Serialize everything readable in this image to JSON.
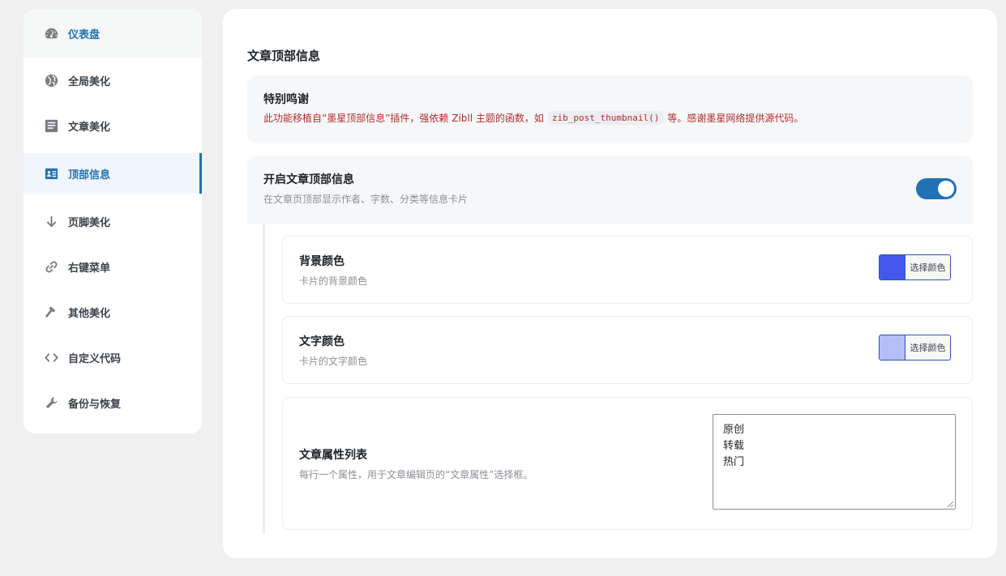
{
  "sidebar": {
    "items": [
      {
        "label": "仪表盘",
        "icon": "dashboard-icon"
      },
      {
        "label": "全局美化",
        "icon": "globe-icon"
      },
      {
        "label": "文章美化",
        "icon": "document-icon"
      },
      {
        "label": "顶部信息",
        "icon": "id-card-icon"
      },
      {
        "label": "页脚美化",
        "icon": "arrow-down-icon"
      },
      {
        "label": "右键菜单",
        "icon": "link-icon"
      },
      {
        "label": "其他美化",
        "icon": "hammer-icon"
      },
      {
        "label": "自定义代码",
        "icon": "code-icon"
      },
      {
        "label": "备份与恢复",
        "icon": "wrench-icon"
      }
    ],
    "active_index": 3
  },
  "main": {
    "section_title": "文章顶部信息",
    "thanks": {
      "title": "特别鸣谢",
      "text_before": "此功能移植自“墨星顶部信息”插件，强依赖 Zibll 主题的函数，如",
      "code": "zib_post_thumbnail()",
      "text_after": "等。感谢墨星网络提供源代码。"
    },
    "enable": {
      "title": "开启文章顶部信息",
      "desc": "在文章页顶部显示作者、字数、分类等信息卡片",
      "enabled": true
    },
    "bg_color": {
      "title": "背景颜色",
      "desc": "卡片的背景颜色",
      "button_label": "选择颜色",
      "value": "#4458ed"
    },
    "text_color": {
      "title": "文字颜色",
      "desc": "卡片的文字颜色",
      "button_label": "选择颜色",
      "value": "#b4bef7"
    },
    "attributes": {
      "title": "文章属性列表",
      "desc": "每行一个属性，用于文章编辑页的“文章属性”选择框。",
      "lines": [
        "原创",
        "转载",
        "热门"
      ]
    }
  },
  "colors": {
    "accent": "#2271b1",
    "warning_text": "#b32d2e"
  }
}
